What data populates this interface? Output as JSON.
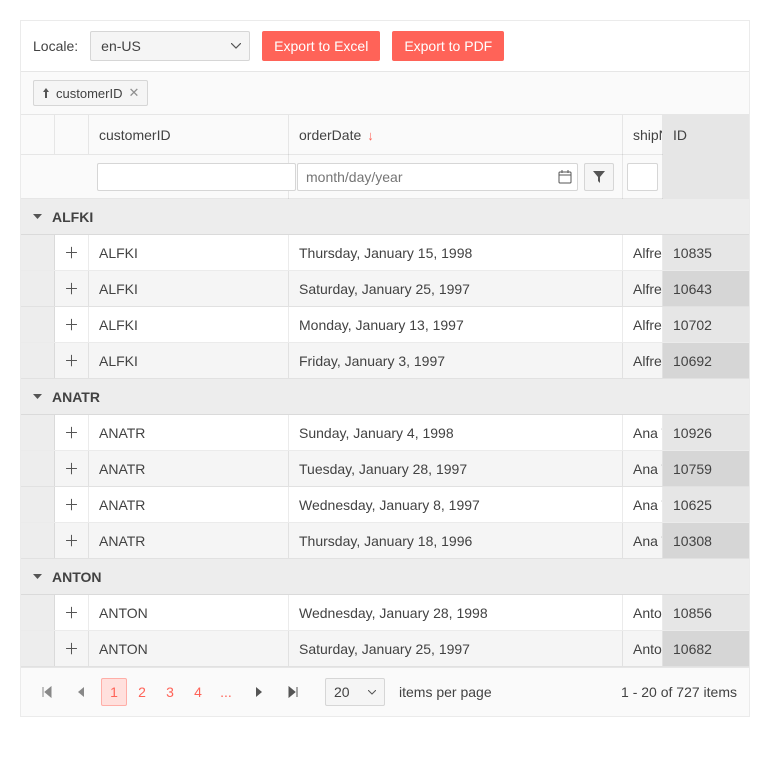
{
  "toolbar": {
    "locale_label": "Locale:",
    "locale_value": "en-US",
    "export_excel_label": "Export to Excel",
    "export_pdf_label": "Export to PDF"
  },
  "group_chip": {
    "label": "customerID"
  },
  "columns": {
    "customerID": "customerID",
    "orderDate": "orderDate",
    "shipName": "shipName",
    "ID": "ID"
  },
  "filters": {
    "date_placeholder": "month/day/year"
  },
  "groups": [
    {
      "label": "ALFKI",
      "rows": [
        {
          "customerID": "ALFKI",
          "orderDate": "Thursday, January 15, 1998",
          "shipName": "Alfreds Futterkiste",
          "ID": "10835"
        },
        {
          "customerID": "ALFKI",
          "orderDate": "Saturday, January 25, 1997",
          "shipName": "Alfreds Futterkiste",
          "ID": "10643"
        },
        {
          "customerID": "ALFKI",
          "orderDate": "Monday, January 13, 1997",
          "shipName": "Alfreds Futterkiste",
          "ID": "10702"
        },
        {
          "customerID": "ALFKI",
          "orderDate": "Friday, January 3, 1997",
          "shipName": "Alfreds Futterkiste",
          "ID": "10692"
        }
      ]
    },
    {
      "label": "ANATR",
      "rows": [
        {
          "customerID": "ANATR",
          "orderDate": "Sunday, January 4, 1998",
          "shipName": "Ana Trujillo",
          "ID": "10926"
        },
        {
          "customerID": "ANATR",
          "orderDate": "Tuesday, January 28, 1997",
          "shipName": "Ana Trujillo",
          "ID": "10759"
        },
        {
          "customerID": "ANATR",
          "orderDate": "Wednesday, January 8, 1997",
          "shipName": "Ana Trujillo",
          "ID": "10625"
        },
        {
          "customerID": "ANATR",
          "orderDate": "Thursday, January 18, 1996",
          "shipName": "Ana Trujillo",
          "ID": "10308"
        }
      ]
    },
    {
      "label": "ANTON",
      "rows": [
        {
          "customerID": "ANTON",
          "orderDate": "Wednesday, January 28, 1998",
          "shipName": "Antonio Moreno",
          "ID": "10856"
        },
        {
          "customerID": "ANTON",
          "orderDate": "Saturday, January 25, 1997",
          "shipName": "Antonio Moreno",
          "ID": "10682"
        }
      ]
    }
  ],
  "pager": {
    "pages": [
      "1",
      "2",
      "3",
      "4",
      "..."
    ],
    "current": "1",
    "page_size": "20",
    "items_per_page_label": "items per page",
    "info": "1 - 20 of 727 items"
  }
}
